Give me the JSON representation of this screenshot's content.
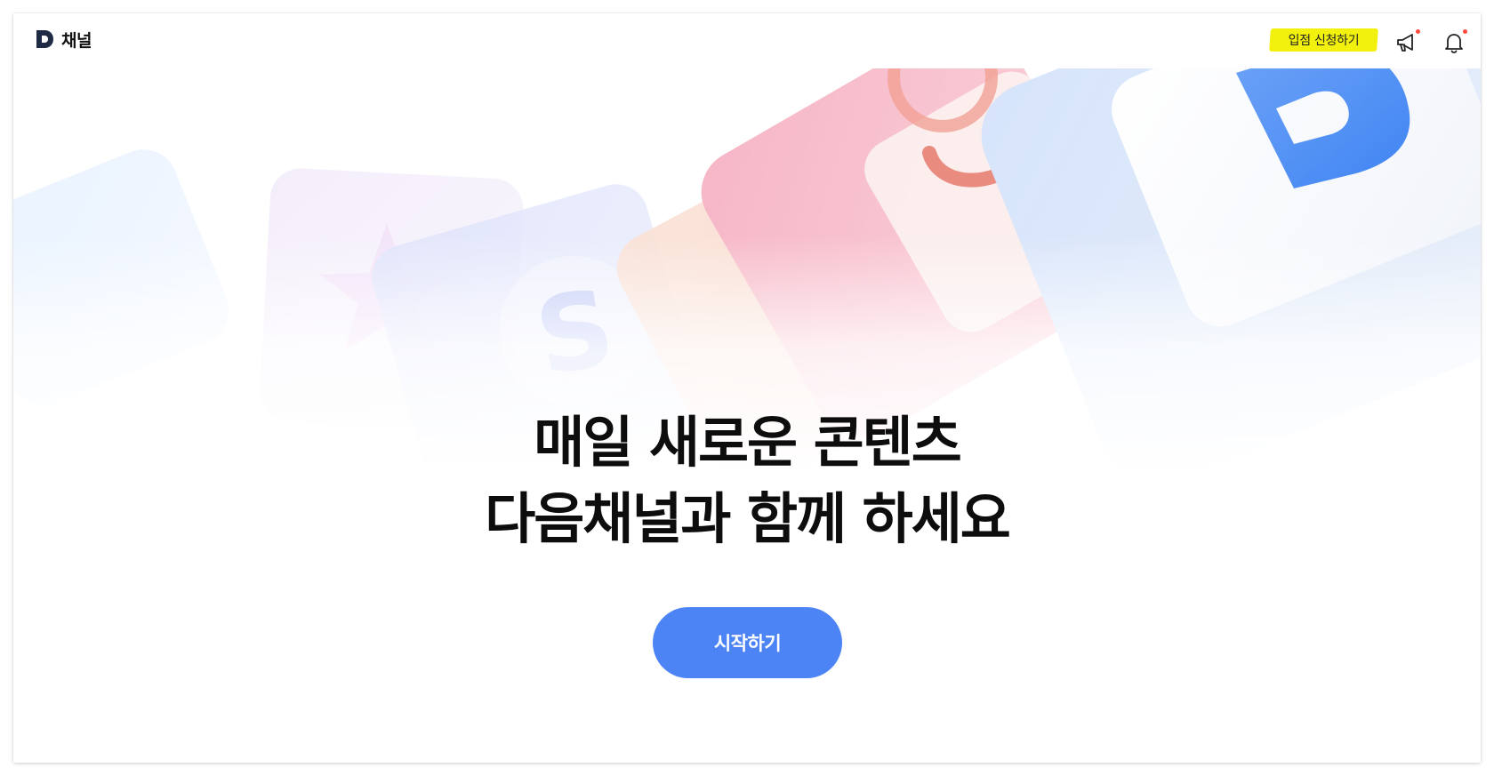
{
  "header": {
    "logo_text": "채널",
    "apply_label": "입점 신청하기",
    "notice_icon": "megaphone-icon",
    "alarm_icon": "bell-icon"
  },
  "hero": {
    "headline_line1": "매일 새로운 콘텐츠",
    "headline_line2": "다음채널과 함께 하세요",
    "start_label": "시작하기",
    "tile_letter_s": "S",
    "tile_letter_d": "D"
  },
  "colors": {
    "accent": "#4d84f5",
    "highlight": "#f0f000",
    "badge": "#ff4b3e",
    "brand_dark": "#1f2a44"
  }
}
